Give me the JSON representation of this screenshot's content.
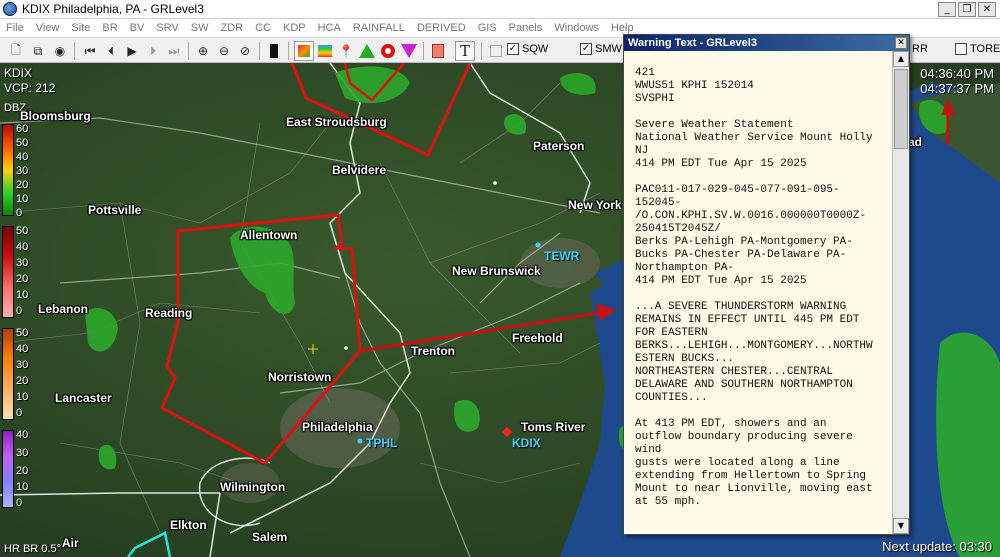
{
  "window": {
    "title": "KDIX Philadelphia, PA - GRLevel3",
    "controls": [
      "_",
      "❐",
      "✕"
    ]
  },
  "menu": [
    "File",
    "View",
    "Site",
    "BR",
    "BV",
    "SRV",
    "SW",
    "ZDR",
    "CC",
    "KDP",
    "HCA",
    "RAINFALL",
    "DERIVED",
    "GIS",
    "Panels",
    "Windows",
    "Help"
  ],
  "toolbar": {
    "sqw_label": "SQW",
    "smw_label": "SMW",
    "rr_label": "RR",
    "tore_label": "TORE"
  },
  "site": {
    "id": "KDIX",
    "vcp": "VCP: 212"
  },
  "colorbar": {
    "label": "DBZ",
    "groups": [
      {
        "ticks": [
          "60",
          "50",
          "40",
          "30",
          "20",
          "10",
          "0"
        ]
      },
      {
        "ticks": [
          "50",
          "40",
          "30",
          "20",
          "10",
          "0"
        ]
      },
      {
        "ticks": [
          "50",
          "40",
          "30",
          "20",
          "10",
          "0"
        ]
      },
      {
        "ticks": [
          "40",
          "30",
          "20",
          "10",
          "0"
        ]
      }
    ]
  },
  "clock": {
    "time1": "04:36:40 PM",
    "time2": "04:37:37 PM"
  },
  "cities": {
    "bloomsburg": "Bloomsburg",
    "pottsville": "Pottsville",
    "lebanon": "Lebanon",
    "lancaster": "Lancaster",
    "reading": "Reading",
    "allentown": "Allentown",
    "norristown": "Norristown",
    "philadelphia": "Philadelphia",
    "wilmington": "Wilmington",
    "elkton": "Elkton",
    "salem": "Salem",
    "east_stroudsburg": "East Stroudsburg",
    "belvidere": "Belvidere",
    "paterson": "Paterson",
    "new_york": "New York",
    "new_brunswick": "New Brunswick",
    "trenton": "Trenton",
    "freehold": "Freehold",
    "toms_river": "Toms River",
    "air": "Air",
    "ad": "ad"
  },
  "radar_sites": {
    "tewr": "TEWR",
    "tphl": "TPHL",
    "kdix": "KDIX"
  },
  "status": {
    "product": "HR BR 0.5°",
    "next_update": "Next update: 03:30"
  },
  "warning_window": {
    "title": "Warning Text - GRLevel3",
    "close": "✕",
    "text": "421\nWWUS51 KPHI 152014\nSVSPHI\n\nSevere Weather Statement\nNational Weather Service Mount Holly\nNJ\n414 PM EDT Tue Apr 15 2025\n\nPAC011-017-029-045-077-091-095-\n152045-\n/O.CON.KPHI.SV.W.0016.000000T0000Z-\n250415T2045Z/\nBerks PA-Lehigh PA-Montgomery PA-\nBucks PA-Chester PA-Delaware PA-\nNorthampton PA-\n414 PM EDT Tue Apr 15 2025\n\n...A SEVERE THUNDERSTORM WARNING\nREMAINS IN EFFECT UNTIL 445 PM EDT\nFOR EASTERN\nBERKS...LEHIGH...MONTGOMERY...NORTHW\nESTERN BUCKS...\nNORTHEASTERN CHESTER...CENTRAL\nDELAWARE AND SOUTHERN NORTHAMPTON\nCOUNTIES...\n\nAt 413 PM EDT, showers and an\noutflow boundary producing severe\nwind\ngusts were located along a line\nextending from Hellertown to Spring\nMount to near Lionville, moving east\nat 55 mph."
  },
  "colors": {
    "warning_polygon": "#e01010",
    "arrow": "#c81010",
    "ocean": "#1d4a8c",
    "land": "#2d4a26",
    "radar_site": "#3ad0ff"
  }
}
